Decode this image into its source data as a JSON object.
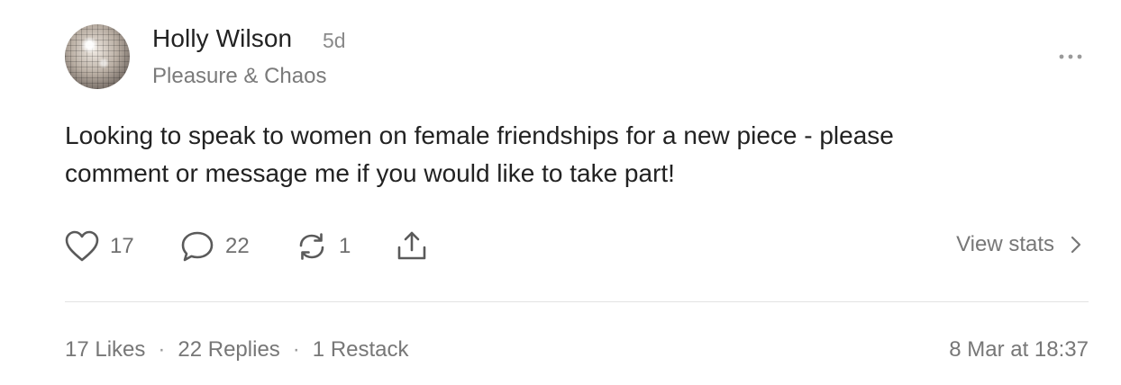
{
  "post": {
    "author": {
      "name": "Holly Wilson",
      "time_ago": "5d",
      "publication": "Pleasure & Chaos",
      "avatar_icon": "disco-ball-avatar"
    },
    "body_line_1": "Looking to speak to women on female friendships for a new piece - please",
    "body_line_2": "comment or message me if you would like to take part!",
    "actions": {
      "likes": "17",
      "replies": "22",
      "restacks": "1",
      "like_icon": "heart-icon",
      "reply_icon": "comment-icon",
      "restack_icon": "restack-icon",
      "share_icon": "share-icon",
      "view_stats_label": "View stats"
    },
    "summary": {
      "likes_label": "17 Likes",
      "separator": "·",
      "replies_label": "22 Replies",
      "restacks_label": "1 Restack"
    },
    "timestamp": "8 Mar at 18:37",
    "colors": {
      "text_primary": "#222222",
      "text_secondary": "#777777",
      "divider": "#e3e3e3"
    }
  }
}
